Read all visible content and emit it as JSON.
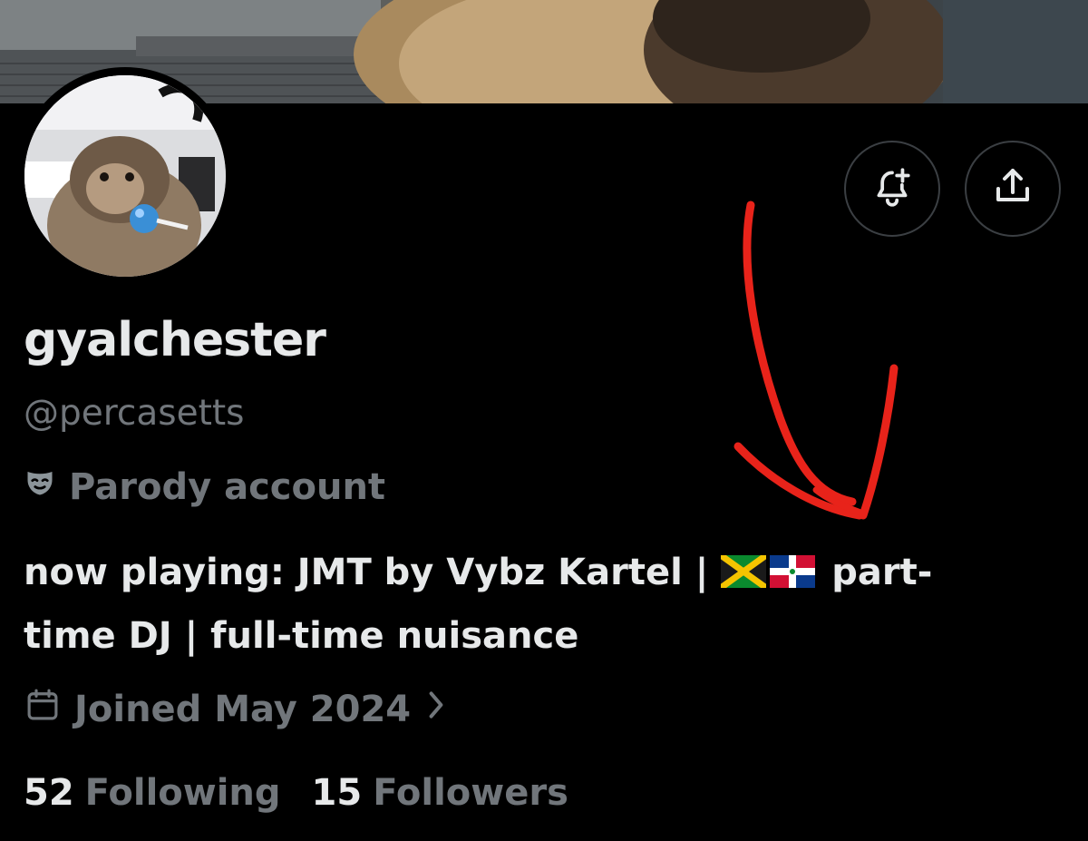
{
  "profile": {
    "display_name": "gyalchester",
    "handle": "@percasetts",
    "label": "Parody account",
    "bio_line1": "now playing: JMT by Vybz Kartel | ",
    "bio_flags": [
      "jamaica-flag",
      "dominican-republic-flag"
    ],
    "bio_line1_end": " part-",
    "bio_line2": "time DJ | full-time nuisance",
    "joined": "Joined May 2024",
    "following_count": "52",
    "following_label": "Following",
    "followers_count": "15",
    "followers_label": "Followers"
  },
  "actions": {
    "notify_icon": "bell-plus-icon",
    "share_icon": "share-icon"
  },
  "annotation": {
    "color": "#e8231a"
  }
}
